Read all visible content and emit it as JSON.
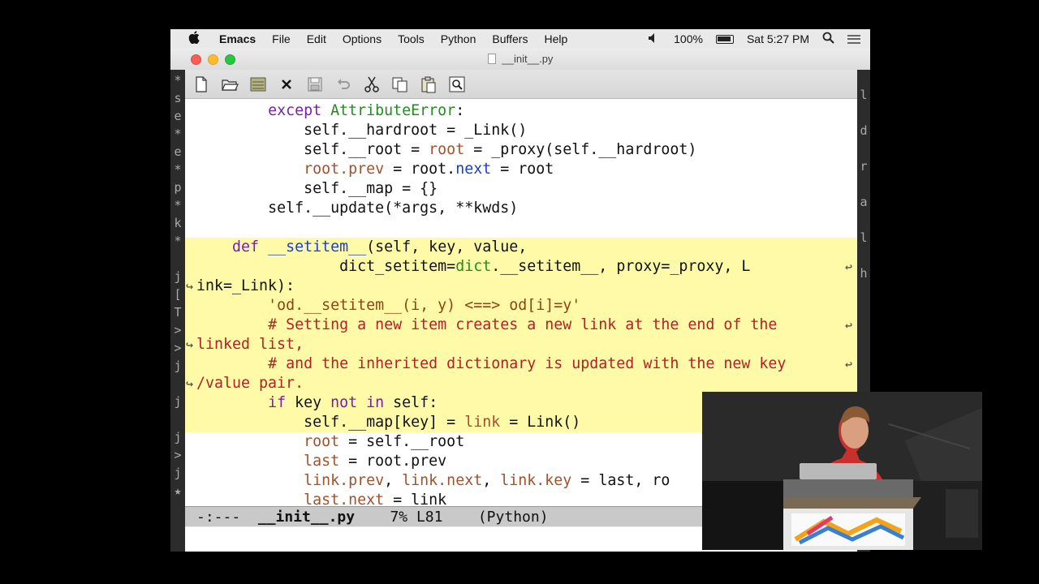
{
  "menubar": {
    "app_name": "Emacs",
    "menus": [
      "File",
      "Edit",
      "Options",
      "Tools",
      "Python",
      "Buffers",
      "Help"
    ],
    "battery": "100%",
    "clock": "Sat 5:27 PM",
    "icons": [
      "apple-icon",
      "volume-icon",
      "battery-icon",
      "search-icon",
      "list-icon"
    ]
  },
  "window": {
    "title": "__init__.py"
  },
  "toolbar": {
    "buttons": [
      "new-file",
      "open-file",
      "open-directory",
      "close-buffer",
      "save",
      "undo",
      "cut",
      "copy",
      "paste",
      "search"
    ]
  },
  "gutter_left": [
    "*",
    "s",
    "e",
    "*",
    "e",
    "*",
    "p",
    "*",
    "k",
    "*",
    "",
    "j",
    "[",
    "T",
    ">",
    ">",
    "j",
    "",
    "j",
    "",
    "j",
    ">",
    "j",
    "★"
  ],
  "gutter_right": [
    "l",
    "",
    "d",
    "",
    "r",
    "",
    "a",
    "",
    "l",
    "",
    "h"
  ],
  "code": {
    "l1a": "except ",
    "l1b": "AttributeError",
    "l1c": ":",
    "l2a": "self.__hardroot = _Link()",
    "l3a": "self.__root = ",
    "l3b": "root",
    "l3c": " = _proxy(self.__hardroot)",
    "l4a": "root.prev",
    "l4b": " = root.",
    "l4c": "next",
    "l4d": " = root",
    "l5a": "self.__map = {}",
    "l6a": "self.__update(*args, **kwds)",
    "l8a": "def ",
    "l8b": "__setitem__",
    "l8c": "(self, key, value,",
    "l9a": "dict_setitem=",
    "l9b": "dict",
    "l9c": ".__setitem__, proxy=_proxy, L",
    "l10a": "ink=_Link):",
    "l11a": "'od.__setitem__(i, y) <==> od[i]=y'",
    "l12a": "# Setting a new item creates a new link at the end of the ",
    "l13a": "linked list,",
    "l14a": "# and the inherited dictionary is updated with the new key",
    "l15a": "/value pair.",
    "l16a": "if ",
    "l16b": "key ",
    "l16c": "not in ",
    "l16d": "self:",
    "l17a": "self.__map[key] = ",
    "l17b": "link",
    "l17c": " = Link()",
    "l18a": "root",
    "l18b": " = self.__root",
    "l19a": "last",
    "l19b": " = root.prev",
    "l20a": "link.prev",
    "l20b": ", ",
    "l20c": "link.next",
    "l20d": ", ",
    "l20e": "link.key",
    "l20f": " = last, ro",
    "l21a": "last.next",
    "l21b": " = link"
  },
  "modeline": {
    "status": "-:---",
    "buffer": "__init__.py",
    "position": "7% L81",
    "mode": "(Python)"
  },
  "colors": {
    "highlight": "#fffaa8",
    "keyword": "#7a1fa2",
    "type": "#228b22",
    "variable": "#a0522d",
    "comment": "#b22222",
    "function": "#1a3fc7"
  }
}
